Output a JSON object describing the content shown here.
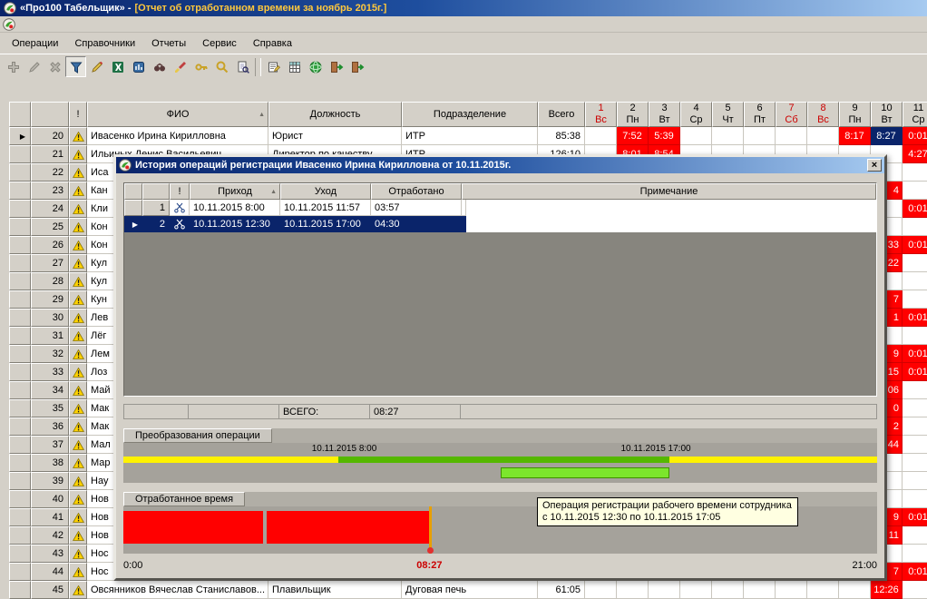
{
  "colors": {
    "t1": "#0A246A",
    "t2": "#A6CAF0",
    "tdoc": "#FFC83C",
    "red": "#FF0000",
    "sel": "#0A246A",
    "yellow": "#FFF200",
    "green": "#55B800",
    "green2": "#7CE62C",
    "orange": "#E8A000",
    "ttbg": "#FFFFE1"
  },
  "window": {
    "title_app": "«Про100 Табельщик» - ",
    "title_doc": "[Отчет об отработанном времени за ноябрь 2015г.]"
  },
  "menu": {
    "items": [
      {
        "label": "Операции",
        "key": "operations"
      },
      {
        "label": "Справочники",
        "key": "directories"
      },
      {
        "label": "Отчеты",
        "key": "reports"
      },
      {
        "label": "Сервис",
        "key": "service"
      },
      {
        "label": "Справка",
        "key": "help"
      }
    ]
  },
  "toolbar": {
    "buttons": [
      {
        "name": "add-icon",
        "glyph": "add",
        "state": "disabled"
      },
      {
        "name": "edit-icon",
        "glyph": "edit",
        "state": "disabled"
      },
      {
        "name": "delete-icon",
        "glyph": "delete",
        "state": "disabled"
      },
      {
        "name": "filter-icon",
        "glyph": "filter",
        "state": "active"
      },
      {
        "name": "pen-icon",
        "glyph": "pen"
      },
      {
        "name": "excel-export-icon",
        "glyph": "excel"
      },
      {
        "name": "report-icon",
        "glyph": "report"
      },
      {
        "name": "view-icon",
        "glyph": "binoculars"
      },
      {
        "name": "format-brush-icon",
        "glyph": "brush"
      },
      {
        "name": "key-icon",
        "glyph": "key"
      },
      {
        "name": "search-icon",
        "glyph": "magnifier"
      },
      {
        "name": "preview-icon",
        "glyph": "docsearch"
      },
      {
        "name": "separator"
      },
      {
        "name": "edit-record-icon",
        "glyph": "notepad"
      },
      {
        "name": "summary-table-icon",
        "glyph": "table"
      },
      {
        "name": "time-globe-icon",
        "glyph": "globe"
      },
      {
        "name": "exit-icon",
        "glyph": "door"
      },
      {
        "name": "logout-icon",
        "glyph": "door"
      }
    ]
  },
  "grid": {
    "headers": {
      "warn": "!",
      "fio": "ФИО",
      "position": "Должность",
      "department": "Подразделение",
      "total": "Всего"
    },
    "day_columns": [
      {
        "day": "1",
        "weekday": "Вс",
        "weekend": true
      },
      {
        "day": "2",
        "weekday": "Пн",
        "weekend": false
      },
      {
        "day": "3",
        "weekday": "Вт",
        "weekend": false
      },
      {
        "day": "4",
        "weekday": "Ср",
        "weekend": false
      },
      {
        "day": "5",
        "weekday": "Чт",
        "weekend": false
      },
      {
        "day": "6",
        "weekday": "Пт",
        "weekend": false
      },
      {
        "day": "7",
        "weekday": "Сб",
        "weekend": true
      },
      {
        "day": "8",
        "weekday": "Вс",
        "weekend": true
      },
      {
        "day": "9",
        "weekday": "Пн",
        "weekend": false
      },
      {
        "day": "10",
        "weekday": "Вт",
        "weekend": false
      },
      {
        "day": "11",
        "weekday": "Ср",
        "weekend": false
      }
    ],
    "rows": [
      {
        "num": "20",
        "fio": "Ивасенко Ирина Кирилловна",
        "position": "Юрист",
        "department": "ИТР",
        "total": "85:38",
        "active": true,
        "days": {
          "2": [
            "7:52",
            "r"
          ],
          "3": [
            "5:39",
            "r"
          ],
          "9": [
            "8:17",
            "r"
          ],
          "10": [
            "8:27",
            "s"
          ],
          "11": [
            "0:01",
            "r"
          ]
        }
      },
      {
        "num": "21",
        "fio": "Ильиных Денис Васильевич",
        "position": "Директор по качеству",
        "department": "ИТР",
        "total": "126:10",
        "days": {
          "2": [
            "8:01",
            "r"
          ],
          "3": [
            "8:54",
            "r"
          ],
          "11": [
            "4:27",
            "r"
          ]
        }
      },
      {
        "num": "22",
        "fio": "Иса"
      },
      {
        "num": "23",
        "fio": "Кан",
        "days": {
          "10": [
            "4",
            "rf"
          ]
        }
      },
      {
        "num": "24",
        "fio": "Кли",
        "days": {
          "11": [
            "0:01",
            "r"
          ]
        }
      },
      {
        "num": "25",
        "fio": "Кон"
      },
      {
        "num": "26",
        "fio": "Кон",
        "days": {
          "10": [
            "33",
            "rf"
          ],
          "11": [
            "0:01",
            "r"
          ]
        }
      },
      {
        "num": "27",
        "fio": "Кул",
        "days": {
          "10": [
            "22",
            "rf"
          ]
        }
      },
      {
        "num": "28",
        "fio": "Кул"
      },
      {
        "num": "29",
        "fio": "Кун",
        "days": {
          "10": [
            "7",
            "rf"
          ]
        }
      },
      {
        "num": "30",
        "fio": "Лев",
        "days": {
          "10": [
            "1",
            "rf"
          ],
          "11": [
            "0:01",
            "r"
          ]
        }
      },
      {
        "num": "31",
        "fio": "Лёг"
      },
      {
        "num": "32",
        "fio": "Лем",
        "days": {
          "10": [
            "9",
            "rf"
          ],
          "11": [
            "0:01",
            "r"
          ]
        }
      },
      {
        "num": "33",
        "fio": "Лоз",
        "days": {
          "10": [
            "15",
            "rf"
          ],
          "11": [
            "0:01",
            "r"
          ]
        }
      },
      {
        "num": "34",
        "fio": "Май",
        "days": {
          "10": [
            "06",
            "rf"
          ]
        }
      },
      {
        "num": "35",
        "fio": "Мак",
        "days": {
          "10": [
            "0",
            "rf"
          ]
        }
      },
      {
        "num": "36",
        "fio": "Мак",
        "days": {
          "10": [
            "2",
            "rf"
          ]
        }
      },
      {
        "num": "37",
        "fio": "Мал",
        "days": {
          "10": [
            "44",
            "rf"
          ]
        }
      },
      {
        "num": "38",
        "fio": "Мар"
      },
      {
        "num": "39",
        "fio": "Нау"
      },
      {
        "num": "40",
        "fio": "Нов"
      },
      {
        "num": "41",
        "fio": "Нов",
        "days": {
          "10": [
            "9",
            "rf"
          ],
          "11": [
            "0:01",
            "r"
          ]
        }
      },
      {
        "num": "42",
        "fio": "Нов",
        "days": {
          "10": [
            "11",
            "rf"
          ]
        }
      },
      {
        "num": "43",
        "fio": "Нос"
      },
      {
        "num": "44",
        "fio": "Нос",
        "days": {
          "10": [
            "7",
            "rf"
          ],
          "11": [
            "0:01",
            "r"
          ]
        }
      },
      {
        "num": "45",
        "fio": "Овсянников Вячеслав Станиславов...",
        "position": "Плавильщик",
        "department": "Дуговая печь",
        "total": "61:05",
        "days": {
          "10": [
            "12:26",
            "r"
          ]
        }
      }
    ]
  },
  "dialog": {
    "title": "История операций регистрации Ивасенко Ирина Кирилловна от 10.11.2015г.",
    "table": {
      "headers": {
        "warn": "!",
        "arrival": "Приход",
        "departure": "Уход",
        "worked": "Отработано",
        "note": "Примечание"
      },
      "rows": [
        {
          "num": "1",
          "arrival": "10.11.2015 8:00",
          "departure": "10.11.2015 11:57",
          "worked": "03:57",
          "note": ""
        },
        {
          "num": "2",
          "arrival": "10.11.2015 12:30",
          "departure": "10.11.2015 17:00",
          "worked": "04:30",
          "note": "",
          "selected": true
        }
      ],
      "total_label": "ВСЕГО:",
      "total_value": "08:27"
    },
    "transform_section": {
      "title": "Преобразования операции",
      "label_start": "10.11.2015 8:00",
      "label_end": "10.11.2015 17:00"
    },
    "worked_section": {
      "title": "Отработанное время",
      "tooltip_line1": "Операция регистрации рабочего времени сотрудника",
      "tooltip_line2": "с 10.11.2015 12:30 по 10.11.2015 17:05"
    },
    "scale": {
      "start": "0:00",
      "current": "08:27",
      "end": "21:00"
    }
  }
}
